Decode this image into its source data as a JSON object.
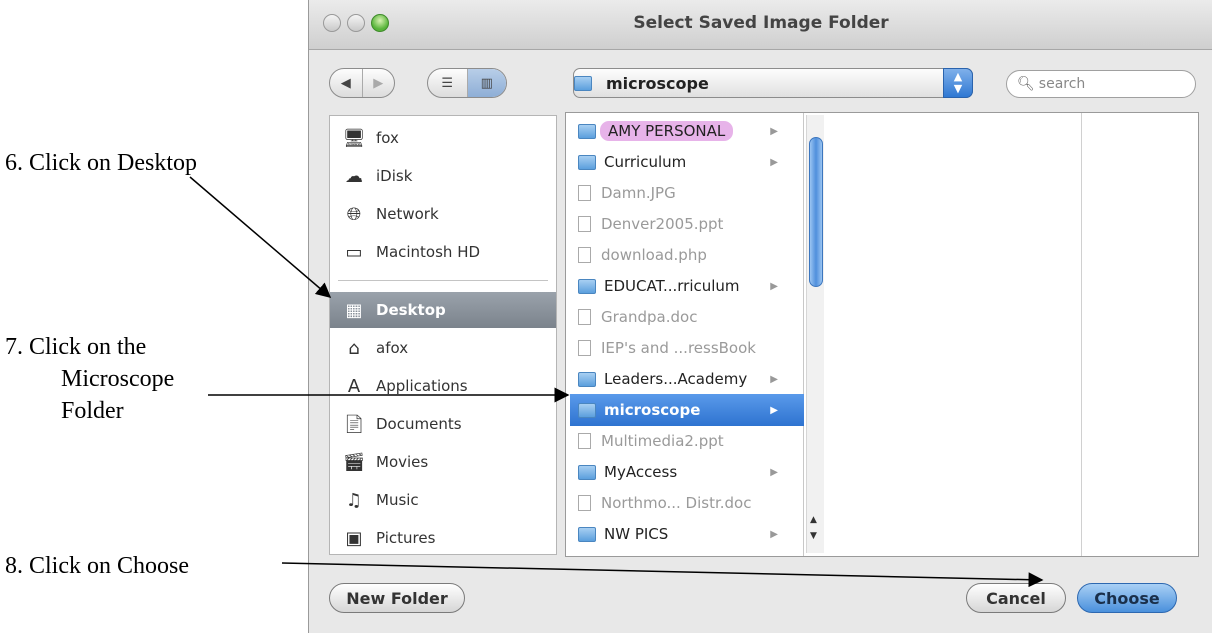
{
  "instructions": {
    "step6": "6.  Click on Desktop",
    "step7_line1": "7.  Click on the",
    "step7_line2": "Microscope",
    "step7_line3": "Folder",
    "step8": "8.  Click on Choose"
  },
  "dialog": {
    "title": "Select Saved Image Folder",
    "location": "microscope",
    "search_placeholder": "search"
  },
  "sidebar": {
    "devices": [
      {
        "label": "fox",
        "icon": "computer-icon"
      },
      {
        "label": "iDisk",
        "icon": "idisk-icon"
      },
      {
        "label": "Network",
        "icon": "network-icon"
      },
      {
        "label": "Macintosh HD",
        "icon": "hard-drive-icon"
      }
    ],
    "places": [
      {
        "label": "Desktop",
        "icon": "desktop-icon",
        "selected": true
      },
      {
        "label": "afox",
        "icon": "home-icon"
      },
      {
        "label": "Applications",
        "icon": "applications-icon"
      },
      {
        "label": "Documents",
        "icon": "documents-icon"
      },
      {
        "label": "Movies",
        "icon": "movies-icon"
      },
      {
        "label": "Music",
        "icon": "music-icon"
      },
      {
        "label": "Pictures",
        "icon": "pictures-icon"
      }
    ]
  },
  "files": [
    {
      "name": "AMY PERSONAL",
      "kind": "folder",
      "label": "pink"
    },
    {
      "name": "Curriculum",
      "kind": "folder"
    },
    {
      "name": "Damn.JPG",
      "kind": "file"
    },
    {
      "name": "Denver2005.ppt",
      "kind": "file"
    },
    {
      "name": "download.php",
      "kind": "file"
    },
    {
      "name": "EDUCAT...rriculum",
      "kind": "folder"
    },
    {
      "name": "Grandpa.doc",
      "kind": "file"
    },
    {
      "name": "IEP's and ...ressBook",
      "kind": "file"
    },
    {
      "name": "Leaders...Academy",
      "kind": "folder"
    },
    {
      "name": "microscope",
      "kind": "folder",
      "selected": true
    },
    {
      "name": "Multimedia2.ppt",
      "kind": "file"
    },
    {
      "name": "MyAccess",
      "kind": "folder"
    },
    {
      "name": "Northmo... Distr.doc",
      "kind": "file"
    },
    {
      "name": "NW PICS",
      "kind": "folder"
    }
  ],
  "buttons": {
    "new_folder": "New Folder",
    "cancel": "Cancel",
    "choose": "Choose"
  },
  "colors": {
    "selection_blue": "#2e73d0",
    "sidebar_selection": "#7b838c",
    "label_pink": "#e7b3e9"
  }
}
